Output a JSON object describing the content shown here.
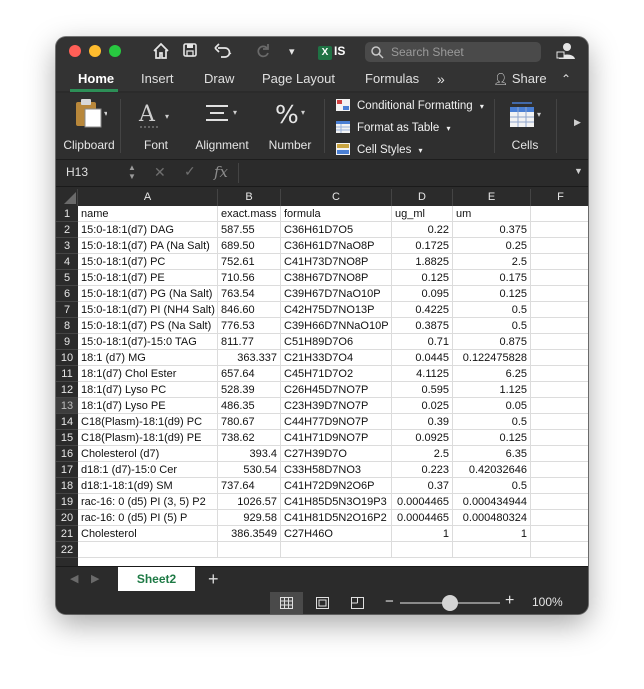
{
  "titlebar": {
    "file_label": "IS",
    "search_placeholder": "Search Sheet"
  },
  "tabs": {
    "items": [
      "Home",
      "Insert",
      "Draw",
      "Page Layout",
      "Formulas"
    ],
    "more": "»",
    "share": "Share",
    "active": "Home"
  },
  "ribbon": {
    "clipboard": "Clipboard",
    "font": "Font",
    "alignment": "Alignment",
    "number": "Number",
    "conditional_formatting": "Conditional Formatting",
    "format_as_table": "Format as Table",
    "cell_styles": "Cell Styles",
    "cells": "Cells"
  },
  "formula_bar": {
    "name_box": "H13",
    "fx": "fx",
    "value": ""
  },
  "grid": {
    "columns": [
      "A",
      "B",
      "C",
      "D",
      "E",
      "F"
    ],
    "selected_row": 13,
    "rows": [
      {
        "num": "1",
        "a": "name",
        "b": "exact.mass",
        "c": "formula",
        "d": "ug_ml",
        "e": "um",
        "header": true
      },
      {
        "num": "2",
        "a": "15:0-18:1(d7) DAG",
        "b": "587.55",
        "c": "C36H61D7O5",
        "d": "0.22",
        "e": "0.375",
        "bnum": false
      },
      {
        "num": "3",
        "a": "15:0-18:1(d7) PA (Na Salt)",
        "b": "689.50",
        "c": "C36H61D7NaO8P",
        "d": "0.1725",
        "e": "0.25",
        "bnum": false
      },
      {
        "num": "4",
        "a": "15:0-18:1(d7) PC",
        "b": "752.61",
        "c": "C41H73D7NO8P",
        "d": "1.8825",
        "e": "2.5",
        "bnum": false
      },
      {
        "num": "5",
        "a": "15:0-18:1(d7) PE",
        "b": "710.56",
        "c": "C38H67D7NO8P",
        "d": "0.125",
        "e": "0.175",
        "bnum": false
      },
      {
        "num": "6",
        "a": "15:0-18:1(d7) PG (Na Salt)",
        "b": "763.54",
        "c": "C39H67D7NaO10P",
        "d": "0.095",
        "e": "0.125",
        "bnum": false
      },
      {
        "num": "7",
        "a": "15:0-18:1(d7) PI (NH4 Salt)",
        "b": "846.60",
        "c": "C42H75D7NO13P",
        "d": "0.4225",
        "e": "0.5",
        "bnum": false
      },
      {
        "num": "8",
        "a": "15:0-18:1(d7) PS (Na Salt)",
        "b": "776.53",
        "c": "C39H66D7NNaO10P",
        "d": "0.3875",
        "e": "0.5",
        "bnum": false
      },
      {
        "num": "9",
        "a": "15:0-18:1(d7)-15:0 TAG",
        "b": "811.77",
        "c": "C51H89D7O6",
        "d": "0.71",
        "e": "0.875",
        "bnum": false
      },
      {
        "num": "10",
        "a": "18:1 (d7) MG",
        "b": "363.337",
        "c": "C21H33D7O4",
        "d": "0.0445",
        "e": "0.122475828",
        "bnum": true
      },
      {
        "num": "11",
        "a": "18:1(d7) Chol Ester",
        "b": "657.64",
        "c": "C45H71D7O2",
        "d": "4.1125",
        "e": "6.25",
        "bnum": false
      },
      {
        "num": "12",
        "a": "18:1(d7) Lyso PC",
        "b": "528.39",
        "c": "C26H45D7NO7P",
        "d": "0.595",
        "e": "1.125",
        "bnum": false
      },
      {
        "num": "13",
        "a": "18:1(d7) Lyso PE",
        "b": "486.35",
        "c": "C23H39D7NO7P",
        "d": "0.025",
        "e": "0.05",
        "bnum": false
      },
      {
        "num": "14",
        "a": "C18(Plasm)-18:1(d9) PC",
        "b": "780.67",
        "c": "C44H77D9NO7P",
        "d": "0.39",
        "e": "0.5",
        "bnum": false
      },
      {
        "num": "15",
        "a": "C18(Plasm)-18:1(d9) PE",
        "b": "738.62",
        "c": "C41H71D9NO7P",
        "d": "0.0925",
        "e": "0.125",
        "bnum": false
      },
      {
        "num": "16",
        "a": "Cholesterol (d7)",
        "b": "393.4",
        "c": "C27H39D7O",
        "d": "2.5",
        "e": "6.35",
        "bnum": true
      },
      {
        "num": "17",
        "a": "d18:1 (d7)-15:0 Cer",
        "b": "530.54",
        "c": "C33H58D7NO3",
        "d": "0.223",
        "e": "0.42032646",
        "bnum": true
      },
      {
        "num": "18",
        "a": "d18:1-18:1(d9) SM",
        "b": "737.64",
        "c": "C41H72D9N2O6P",
        "d": "0.37",
        "e": "0.5",
        "bnum": false
      },
      {
        "num": "19",
        "a": "rac-16: 0 (d5) PI (3, 5) P2",
        "b": "1026.57",
        "c": "C41H85D5N3O19P3",
        "d": "0.0004465",
        "e": "0.000434944",
        "bnum": true
      },
      {
        "num": "20",
        "a": "rac-16: 0 (d5) PI (5) P",
        "b": "929.58",
        "c": "C41H81D5N2O16P2",
        "d": "0.0004465",
        "e": "0.000480324",
        "bnum": true
      },
      {
        "num": "21",
        "a": "Cholesterol",
        "b": "386.3549",
        "c": "C27H46O",
        "d": "1",
        "e": "1",
        "bnum": true
      },
      {
        "num": "22",
        "a": "",
        "b": "",
        "c": "",
        "d": "",
        "e": "",
        "bnum": false
      }
    ]
  },
  "sheets": {
    "active": "Sheet2",
    "add": "+"
  },
  "status": {
    "zoom": "100%",
    "zoom_level": 1.0
  },
  "colors": {
    "accent_green": "#1e7a45",
    "dark_chrome": "#2b2b2b"
  }
}
